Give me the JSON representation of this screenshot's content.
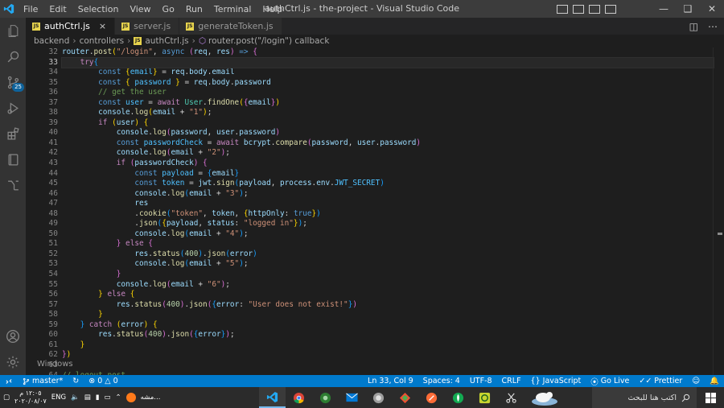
{
  "titlebar": {
    "title": "authCtrl.js - the-project - Visual Studio Code",
    "menu": [
      "File",
      "Edit",
      "Selection",
      "View",
      "Go",
      "Run",
      "Terminal",
      "Help"
    ]
  },
  "activity": {
    "badge": "25"
  },
  "tabs": [
    {
      "label": "authCtrl.js",
      "active": true
    },
    {
      "label": "server.js",
      "active": false
    },
    {
      "label": "generateToken.js",
      "active": false
    }
  ],
  "breadcrumb": [
    "backend",
    "controllers",
    "authCtrl.js",
    "router.post(\"/login\") callback"
  ],
  "editor": {
    "current_line": 33,
    "lines": [
      {
        "n": 32,
        "html": "<span class='v'>router</span>.<span class='f'>post</span><span class='b1'>(</span><span class='s'>\"/login\"</span>, <span class='k'>async</span> <span class='b2'>(</span><span class='v'>req</span>, <span class='v'>res</span><span class='b2'>)</span> <span class='k'>=&gt;</span> <span class='b2'>{</span>"
      },
      {
        "n": 33,
        "html": "    <span class='kc'>try</span><span class='b3'>{</span>"
      },
      {
        "n": 34,
        "html": "        <span class='k'>const</span> <span class='b1'>{</span><span class='cst'>email</span><span class='b1'>}</span> = <span class='v'>req</span>.<span class='v'>body</span>.<span class='v'>email</span>"
      },
      {
        "n": 35,
        "html": "        <span class='k'>const</span> <span class='b1'>{</span> <span class='cst'>password</span> <span class='b1'>}</span> = <span class='v'>req</span>.<span class='v'>body</span>.<span class='v'>password</span>"
      },
      {
        "n": 36,
        "html": "        <span class='c'>// get the user</span>"
      },
      {
        "n": 37,
        "html": "        <span class='k'>const</span> <span class='cst'>user</span> = <span class='kc'>await</span> <span class='cls'>User</span>.<span class='f'>findOne</span><span class='b1'>(</span><span class='b2'>{</span><span class='v'>email</span><span class='b2'>}</span><span class='b1'>)</span>"
      },
      {
        "n": 38,
        "html": "        <span class='v'>console</span>.<span class='f'>log</span><span class='b1'>(</span><span class='v'>email</span> + <span class='s'>\"1\"</span><span class='b1'>)</span>;"
      },
      {
        "n": 39,
        "html": "        <span class='kc'>if</span> <span class='b1'>(</span><span class='v'>user</span><span class='b1'>)</span> <span class='b1'>{</span>"
      },
      {
        "n": 40,
        "html": "            <span class='v'>console</span>.<span class='f'>log</span><span class='b2'>(</span><span class='v'>password</span>, <span class='v'>user</span>.<span class='v'>password</span><span class='b2'>)</span>"
      },
      {
        "n": 41,
        "html": "            <span class='k'>const</span> <span class='cst'>passwordCheck</span> = <span class='kc'>await</span> <span class='v'>bcrypt</span>.<span class='f'>compare</span><span class='b2'>(</span><span class='v'>password</span>, <span class='v'>user</span>.<span class='v'>password</span><span class='b2'>)</span>"
      },
      {
        "n": 42,
        "html": "            <span class='v'>console</span>.<span class='f'>log</span><span class='b2'>(</span><span class='v'>email</span> + <span class='s'>\"2\"</span><span class='b2'>)</span>;"
      },
      {
        "n": 43,
        "html": "            <span class='kc'>if</span> <span class='b2'>(</span><span class='v'>passwordCheck</span><span class='b2'>)</span> <span class='b2'>{</span>"
      },
      {
        "n": 44,
        "html": "                <span class='k'>const</span> <span class='cst'>payload</span> = <span class='b3'>{</span><span class='v'>email</span><span class='b3'>}</span>"
      },
      {
        "n": 45,
        "html": "                <span class='k'>const</span> <span class='cst'>token</span> = <span class='v'>jwt</span>.<span class='f'>sign</span><span class='b3'>(</span><span class='v'>payload</span>, <span class='v'>process</span>.<span class='v'>env</span>.<span class='cst'>JWT_SECRET</span><span class='b3'>)</span>"
      },
      {
        "n": 46,
        "html": "                <span class='v'>console</span>.<span class='f'>log</span><span class='b3'>(</span><span class='v'>email</span> + <span class='s'>\"3\"</span><span class='b3'>)</span>;"
      },
      {
        "n": 47,
        "html": "                <span class='v'>res</span>"
      },
      {
        "n": 48,
        "html": "                .<span class='f'>cookie</span><span class='b3'>(</span><span class='s'>\"token\"</span>, <span class='v'>token</span>, <span class='b1'>{</span><span class='v'>httpOnly</span>: <span class='k'>true</span><span class='b1'>}</span><span class='b3'>)</span>"
      },
      {
        "n": 49,
        "html": "                .<span class='f'>json</span><span class='b3'>(</span><span class='b1'>{</span><span class='v'>payload</span>, <span class='v'>status</span>: <span class='s'>\"logged in\"</span><span class='b1'>}</span><span class='b3'>)</span>;"
      },
      {
        "n": 50,
        "html": "                <span class='v'>console</span>.<span class='f'>log</span><span class='b3'>(</span><span class='v'>email</span> + <span class='s'>\"4\"</span><span class='b3'>)</span>;"
      },
      {
        "n": 51,
        "html": "            <span class='b2'>}</span> <span class='kc'>else</span> <span class='b2'>{</span>"
      },
      {
        "n": 52,
        "html": "                <span class='v'>res</span>.<span class='f'>status</span><span class='b3'>(</span><span class='n'>400</span><span class='b3'>)</span>.<span class='f'>json</span><span class='b3'>(</span><span class='v'>error</span><span class='b3'>)</span>"
      },
      {
        "n": 53,
        "html": "                <span class='v'>console</span>.<span class='f'>log</span><span class='b3'>(</span><span class='v'>email</span> + <span class='s'>\"5\"</span><span class='b3'>)</span>;"
      },
      {
        "n": 54,
        "html": "            <span class='b2'>}</span>"
      },
      {
        "n": 55,
        "html": "            <span class='v'>console</span>.<span class='f'>log</span><span class='b2'>(</span><span class='v'>email</span> + <span class='s'>\"6\"</span><span class='b2'>)</span>;"
      },
      {
        "n": 56,
        "html": "        <span class='b1'>}</span> <span class='kc'>else</span> <span class='b1'>{</span>"
      },
      {
        "n": 57,
        "html": "            <span class='v'>res</span>.<span class='f'>status</span><span class='b2'>(</span><span class='n'>400</span><span class='b2'>)</span>.<span class='f'>json</span><span class='b2'>(</span><span class='b3'>{</span><span class='v'>error</span>: <span class='s'>\"User does not exist!\"</span><span class='b3'>}</span><span class='b2'>)</span>"
      },
      {
        "n": 58,
        "html": "        <span class='b1'>}</span>"
      },
      {
        "n": 59,
        "html": "    <span class='b3'>}</span> <span class='kc'>catch</span> <span class='b1'>(</span><span class='v'>error</span><span class='b1'>)</span> <span class='b1'>{</span>"
      },
      {
        "n": 60,
        "html": "        <span class='v'>res</span>.<span class='f'>status</span><span class='b2'>(</span><span class='n'>400</span><span class='b2'>)</span>.<span class='f'>json</span><span class='b2'>(</span><span class='b3'>{</span><span class='v'>error</span><span class='b3'>}</span><span class='b2'>)</span>;"
      },
      {
        "n": 61,
        "html": "    <span class='b1'>}</span>"
      },
      {
        "n": 62,
        "html": "<span class='b2'>}</span><span class='b1'>)</span>"
      },
      {
        "n": 63,
        "html": ""
      },
      {
        "n": 64,
        "html": "<span class='c'>// logout post</span>"
      }
    ]
  },
  "watermark": "Windows",
  "statusbar": {
    "branch": "master*",
    "errors": "0",
    "warnings": "0",
    "position": "Ln 33, Col 9",
    "spaces": "Spaces: 4",
    "encoding": "UTF-8",
    "eol": "CRLF",
    "language": "JavaScript",
    "golive": "Go Live",
    "prettier": "Prettier"
  },
  "taskbar": {
    "time": "١٢:٠٥ م",
    "date": "٢٠٢٠/٠٨/٠٧",
    "lang": "ENG",
    "notification_text": "مشه...",
    "search_placeholder": "اكتب هنا للبحث"
  },
  "colors": {
    "statusbar": "#007acc",
    "editor_bg": "#1e1e1e",
    "titlebar": "#3c3c3c",
    "accent": "#0e639c"
  }
}
